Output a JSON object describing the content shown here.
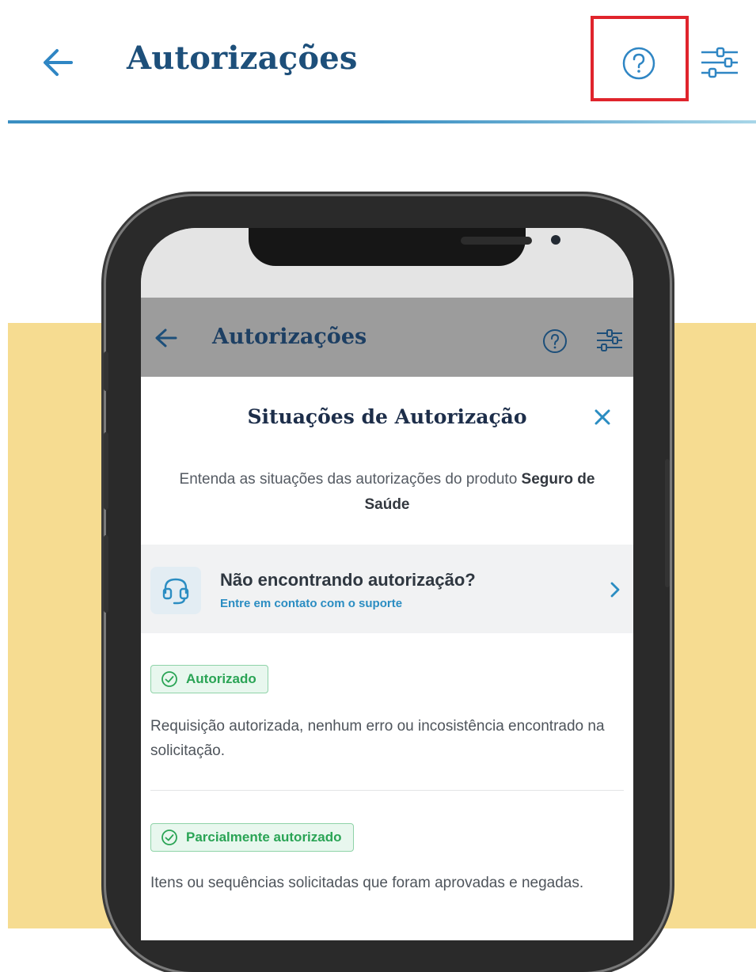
{
  "header": {
    "title": "Autorizações",
    "back_icon": "arrow-left-icon",
    "help_icon": "question-circle-icon",
    "filter_icon": "sliders-icon",
    "accent_color": "#1d4f7a",
    "highlight_color": "#e0242c"
  },
  "phone": {
    "app_header": {
      "title": "Autorizações",
      "back_icon": "arrow-left-icon",
      "help_icon": "question-circle-icon",
      "filter_icon": "sliders-icon"
    },
    "modal": {
      "title": "Situações de Autorização",
      "close_icon": "close-icon",
      "subtitle_prefix": "Entenda as situações das autorizações do produto",
      "subtitle_product": "Seguro de Saúde",
      "support": {
        "icon": "headset-icon",
        "title": "Não encontrando autorização?",
        "link": "Entre em contato com o suporte",
        "chevron_icon": "chevron-right-icon"
      },
      "statuses": [
        {
          "label": "Autorizado",
          "icon": "check-circle-icon",
          "description": "Requisição autorizada, nenhum erro ou incosistência encontrado na solicitação."
        },
        {
          "label": "Parcialmente autorizado",
          "icon": "check-circle-icon",
          "description": "Itens ou sequências solicitadas que foram aprovadas e negadas."
        }
      ]
    }
  },
  "colors": {
    "background_yellow": "#f6dc91",
    "status_green": "#2aa455",
    "link_blue": "#2b8dc2"
  }
}
